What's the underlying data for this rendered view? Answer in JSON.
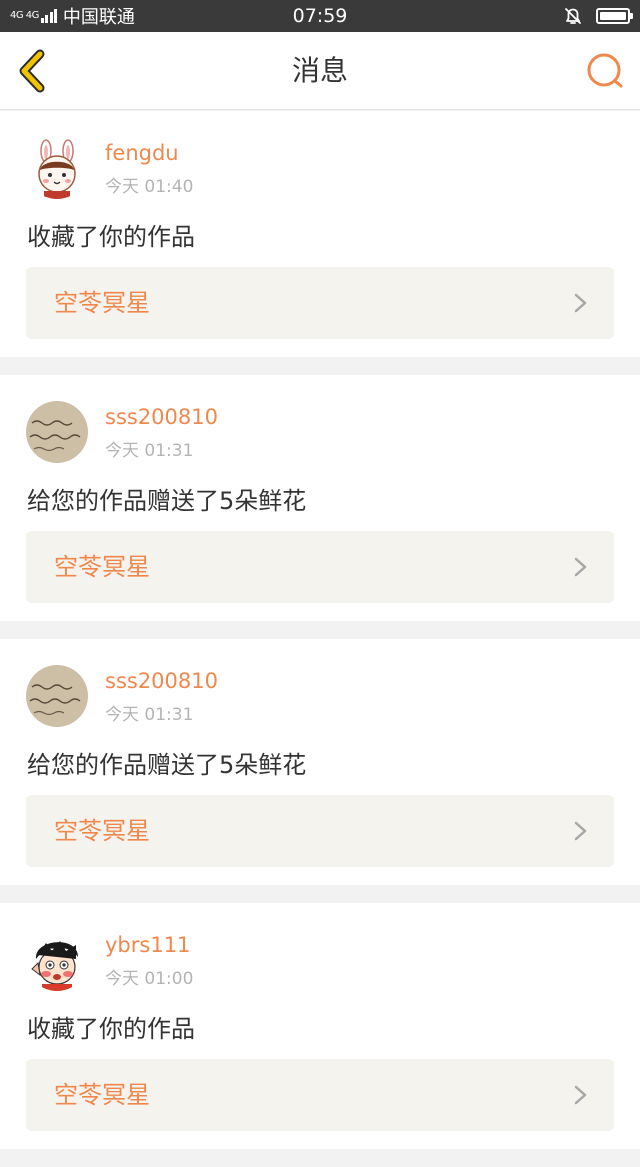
{
  "status_bar": {
    "network": "4G 4G",
    "carrier": "中国联通",
    "time": "07:59"
  },
  "header": {
    "title": "消息",
    "back_icon": "chevron-left-icon",
    "search_icon": "search-icon"
  },
  "colors": {
    "accent": "#f0884d",
    "back_icon": "#f2c400",
    "text": "#333333",
    "secondary": "#b4b4b4",
    "card_link_bg": "#f5f3ee"
  },
  "messages": [
    {
      "username": "fengdu",
      "time": "今天 01:40",
      "action": "收藏了你的作品",
      "work": "空苓冥星"
    },
    {
      "username": "sss200810",
      "time": "今天 01:31",
      "action": "给您的作品赠送了5朵鲜花",
      "work": "空苓冥星"
    },
    {
      "username": "sss200810",
      "time": "今天 01:31",
      "action": "给您的作品赠送了5朵鲜花",
      "work": "空苓冥星"
    },
    {
      "username": "ybrs111",
      "time": "今天 01:00",
      "action": "收藏了你的作品",
      "work": "空苓冥星"
    }
  ]
}
